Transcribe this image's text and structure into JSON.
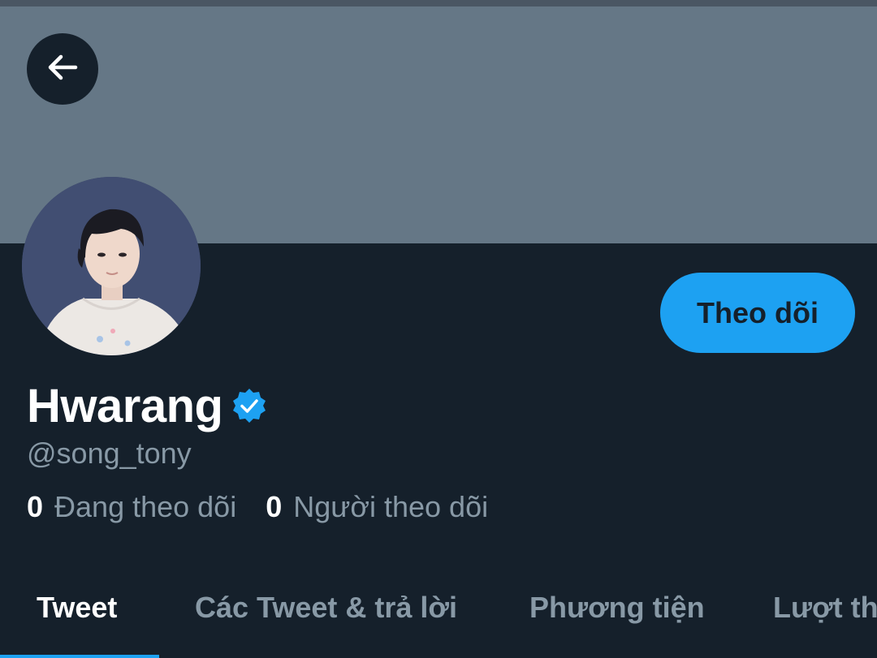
{
  "profile": {
    "display_name": "Hwarang",
    "handle": "@song_tony",
    "verified": true
  },
  "actions": {
    "follow_label": "Theo dõi"
  },
  "stats": {
    "following_count": "0",
    "following_label": "Đang theo dõi",
    "followers_count": "0",
    "followers_label": "Người theo dõi"
  },
  "tabs": [
    {
      "label": "Tweet",
      "active": true
    },
    {
      "label": "Các Tweet & trả lời",
      "active": false
    },
    {
      "label": "Phương tiện",
      "active": false
    },
    {
      "label": "Lượt thích",
      "active": false
    }
  ],
  "icons": {
    "back": "arrow-left-icon",
    "verified": "verified-badge-icon"
  },
  "colors": {
    "background": "#15202b",
    "banner": "#657786",
    "accent": "#1da1f2",
    "secondary_text": "#8899a6"
  }
}
